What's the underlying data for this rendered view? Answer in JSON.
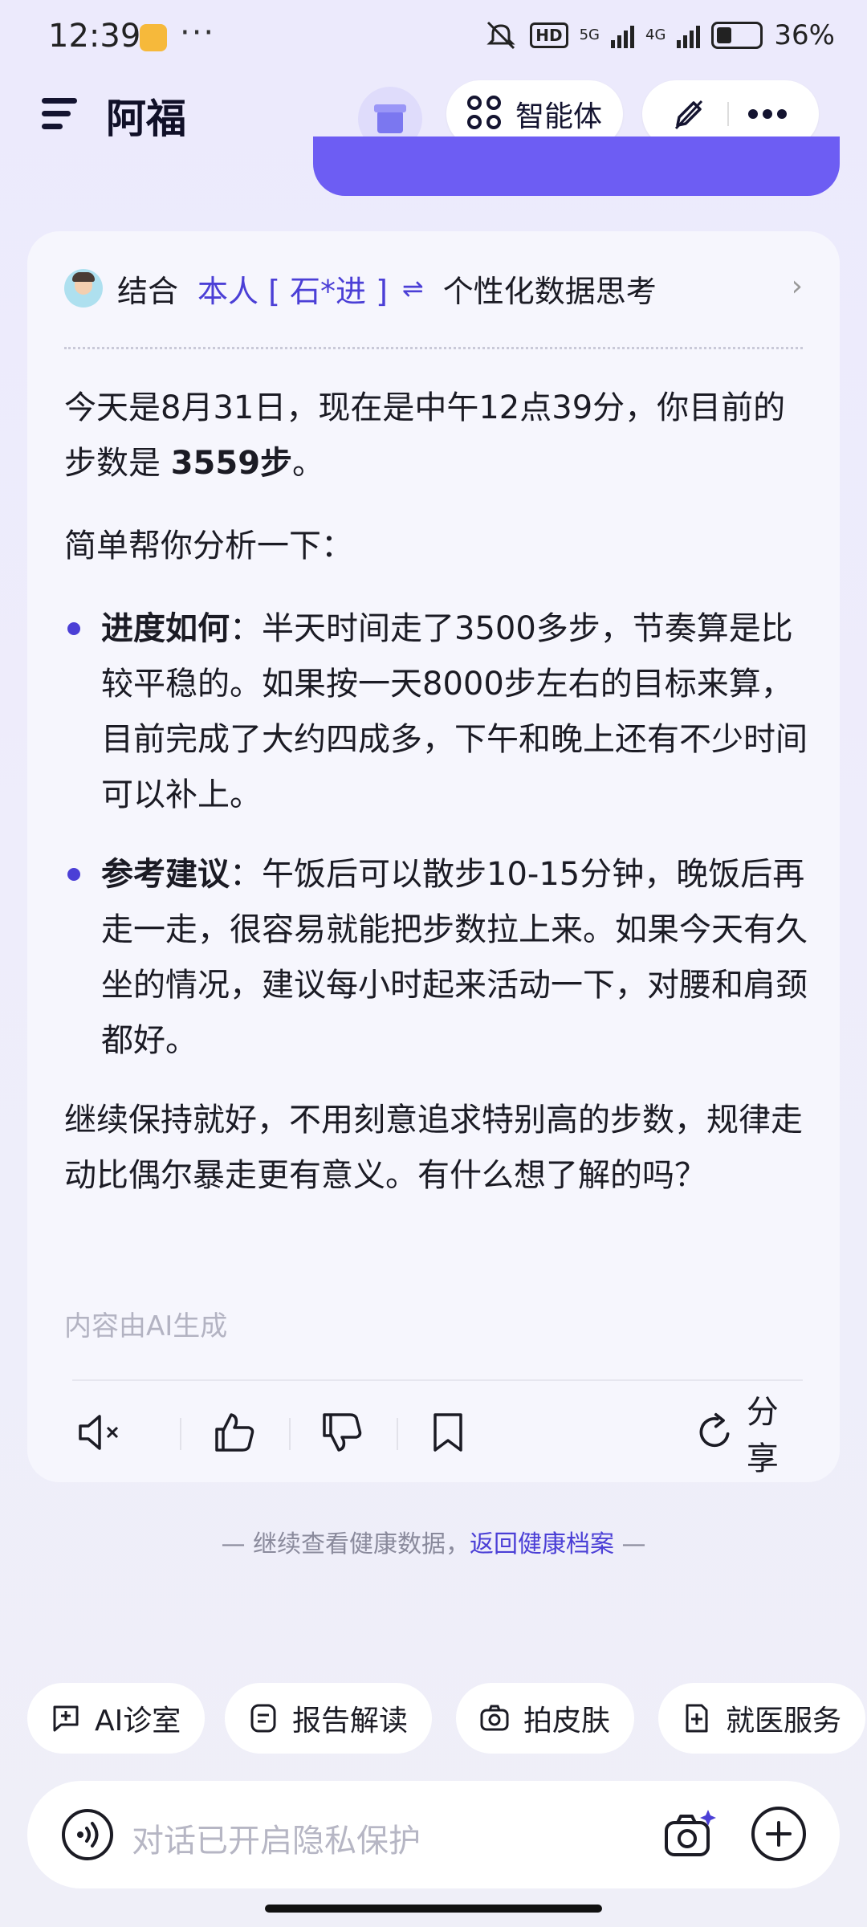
{
  "status_bar": {
    "time": "12:39",
    "dots": "···",
    "hd_label": "HD",
    "net1": "5G",
    "net2": "4G",
    "battery": "36%"
  },
  "header": {
    "title": "阿福",
    "agent_label": "智能体"
  },
  "context": {
    "prefix": "结合",
    "person": "本人 [ 石*进 ]",
    "swap": "⇌",
    "suffix": "个性化数据思考"
  },
  "message": {
    "para1_a": "今天是8月31日，现在是中午12点39分，你目前的步数是 ",
    "para1_bold": "3559步",
    "para1_b": "。",
    "para2": "简单帮你分析一下：",
    "bullets": [
      {
        "title": "进度如何",
        "text": "：半天时间走了3500多步，节奏算是比较平稳的。如果按一天8000步左右的目标来算，目前完成了大约四成多，下午和晚上还有不少时间可以补上。"
      },
      {
        "title": "参考建议",
        "text": "：午饭后可以散步10-15分钟，晚饭后再走一走，很容易就能把步数拉上来。如果今天有久坐的情况，建议每小时起来活动一下，对腰和肩颈都好。"
      }
    ],
    "para_final": "继续保持就好，不用刻意追求特别高的步数，规律走动比偶尔暴走更有意义。有什么想了解的吗？",
    "ai_note": "内容由AI生成",
    "share_label": "分享"
  },
  "footer_hint": {
    "prefix": "— 继续查看健康数据，",
    "link": "返回健康档案",
    "suffix": " —"
  },
  "chips": [
    {
      "label": "AI诊室",
      "icon": "chat-plus-icon"
    },
    {
      "label": "报告解读",
      "icon": "report-icon"
    },
    {
      "label": "拍皮肤",
      "icon": "camera-icon"
    },
    {
      "label": "就医服务",
      "icon": "medical-doc-icon"
    }
  ],
  "input": {
    "placeholder": "对话已开启隐私保护"
  },
  "colors": {
    "accent": "#4b3fd6",
    "banner": "#6d5df3",
    "background": "#eceafc"
  }
}
